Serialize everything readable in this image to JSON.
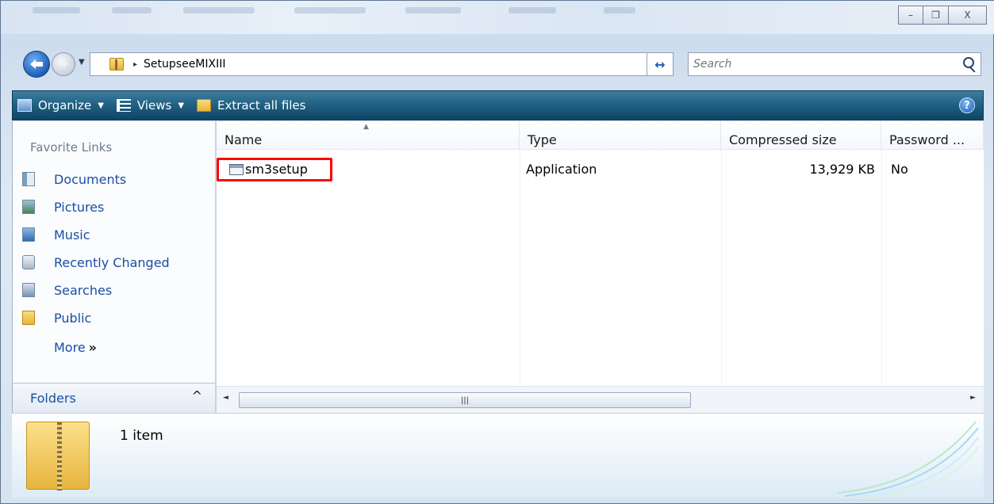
{
  "window": {
    "caption_buttons": {
      "minimize_glyph": "–",
      "restore_glyph": "❐",
      "close_glyph": "X"
    }
  },
  "address_bar": {
    "crumb_separator": "▸",
    "breadcrumb": "SetupseeMIXIII",
    "dropdown_glyph": "▼",
    "refresh_glyph": "↔"
  },
  "search": {
    "placeholder": "Search"
  },
  "toolbar": {
    "organize_label": "Organize",
    "views_label": "Views",
    "extract_label": "Extract all files",
    "dropdown_glyph": "▼",
    "help_glyph": "?"
  },
  "nav_pane": {
    "heading": "Favorite Links",
    "items": [
      {
        "label": "Documents",
        "icon": "documents-icon"
      },
      {
        "label": "Pictures",
        "icon": "pictures-icon"
      },
      {
        "label": "Music",
        "icon": "music-icon"
      },
      {
        "label": "Recently Changed",
        "icon": "recently-changed-icon"
      },
      {
        "label": "Searches",
        "icon": "searches-icon"
      },
      {
        "label": "Public",
        "icon": "public-folder-icon"
      }
    ],
    "more_label": "More",
    "more_glyph": "»",
    "folders_label": "Folders",
    "folders_chevron": "^"
  },
  "file_list": {
    "columns": [
      "Name",
      "Type",
      "Compressed size",
      "Password ..."
    ],
    "sort_glyph": "▲",
    "rows": [
      {
        "name": "sm3setup",
        "type": "Application",
        "compressed_size": "13,929 KB",
        "password": "No"
      }
    ],
    "scroll_left_glyph": "◄",
    "scroll_right_glyph": "►",
    "scroll_thumb_glyph": "|||"
  },
  "details_pane": {
    "item_count": "1 item"
  },
  "colors": {
    "toolbar": "#1f5f82",
    "link": "#1a4ea3",
    "highlight_box": "#ff0000"
  }
}
